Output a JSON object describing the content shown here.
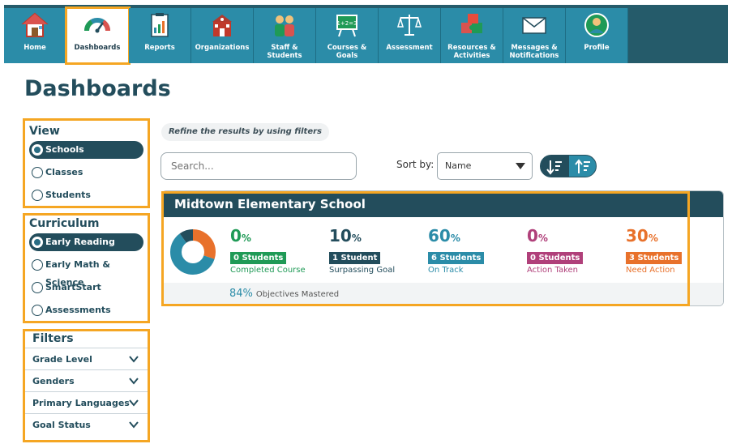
{
  "nav": {
    "tabs": [
      {
        "label": "Home",
        "icon": "house-icon"
      },
      {
        "label": "Dashboards",
        "icon": "gauge-icon"
      },
      {
        "label": "Reports",
        "icon": "report-icon"
      },
      {
        "label": "Organizations",
        "icon": "school-building-icon"
      },
      {
        "label": "Staff & Students",
        "icon": "people-icon"
      },
      {
        "label": "Courses & Goals",
        "icon": "easel-icon"
      },
      {
        "label": "Assessment",
        "icon": "scales-icon"
      },
      {
        "label": "Resources & Activities",
        "icon": "puzzle-icon"
      },
      {
        "label": "Messages & Notifications",
        "icon": "envelope-icon"
      },
      {
        "label": "Profile",
        "icon": "user-icon"
      }
    ]
  },
  "page": {
    "title": "Dashboards"
  },
  "view": {
    "title": "View",
    "options": [
      {
        "label": "Schools",
        "selected": true
      },
      {
        "label": "Classes",
        "selected": false
      },
      {
        "label": "Students",
        "selected": false
      }
    ]
  },
  "curriculum": {
    "title": "Curriculum",
    "options": [
      {
        "label": "Early Reading",
        "selected": true
      },
      {
        "label": "Early Math & Science",
        "selected": false
      },
      {
        "label": "SmartStart",
        "selected": false
      },
      {
        "label": "Assessments",
        "selected": false
      }
    ]
  },
  "filters": {
    "title": "Filters",
    "items": [
      "Grade Level",
      "Genders",
      "Primary Languages",
      "Goal Status"
    ]
  },
  "toolbar": {
    "hint": "Refine the results by using filters",
    "search_placeholder": "Search...",
    "sort_label": "Sort by:",
    "sort_value": "Name"
  },
  "school_card": {
    "name": "Midtown Elementary School",
    "donut": [
      {
        "value": 30,
        "color": "#e8712b"
      },
      {
        "value": 60,
        "color": "#2b8ca8"
      },
      {
        "value": 10,
        "color": "#234d5c"
      }
    ],
    "stats": [
      {
        "pct": "0",
        "sym": "%",
        "badge": "0 Students",
        "caption": "Completed Course",
        "color": "#1f9a56"
      },
      {
        "pct": "10",
        "sym": "%",
        "badge": "1 Student",
        "caption": "Surpassing Goal",
        "color": "#234d5c"
      },
      {
        "pct": "60",
        "sym": "%",
        "badge": "6 Students",
        "caption": "On Track",
        "color": "#2b8ca8"
      },
      {
        "pct": "0",
        "sym": "%",
        "badge": "0 Students",
        "caption": "Action Taken",
        "color": "#b0407a"
      },
      {
        "pct": "30",
        "sym": "%",
        "badge": "3 Students",
        "caption": "Need Action",
        "color": "#e8712b"
      }
    ],
    "mastered_value": "84%",
    "mastered_label": "Objectives Mastered"
  },
  "colors": {
    "accent": "#2b8ca8",
    "dark": "#234d5c",
    "highlight": "#f5a623"
  }
}
